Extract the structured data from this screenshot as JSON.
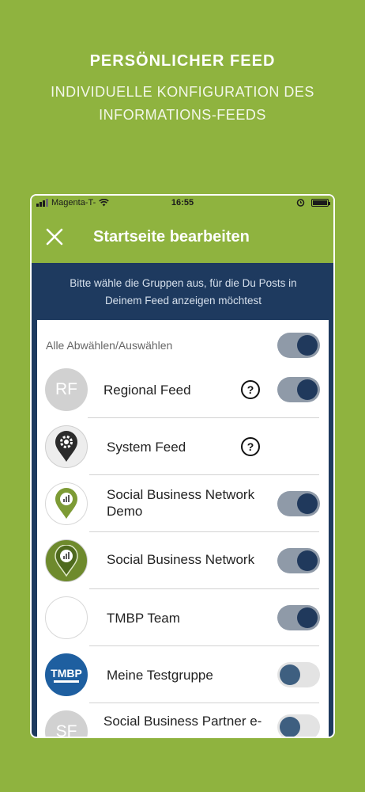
{
  "promo": {
    "title": "PERSÖNLICHER FEED",
    "subtitle_line1": "INDIVIDUELLE KONFIGURATION DES",
    "subtitle_line2": "INFORMATIONS-FEEDS"
  },
  "statusbar": {
    "carrier": "Magenta-T-",
    "time": "16:55"
  },
  "appbar": {
    "close_icon": "close-icon",
    "title": "Startseite bearbeiten"
  },
  "intro": {
    "line1": "Bitte wähle die Gruppen aus, für die Du Posts in",
    "line2": "Deinem Feed anzeigen möchtest"
  },
  "select_all": {
    "label": "Alle Abwählen/Auswählen",
    "on": true
  },
  "groups": [
    {
      "avatar_text": "RF",
      "label": "Regional Feed",
      "help": "?",
      "toggle_on": true
    },
    {
      "icon": "gear-pin-icon",
      "label": "System Feed",
      "help": "?"
    },
    {
      "icon": "map-pin-chart-icon",
      "label": "Social Business Network Demo",
      "toggle_on": true
    },
    {
      "icon": "map-pin-chart-icon",
      "label": "Social Business Network",
      "toggle_on": true
    },
    {
      "label": "TMBP Team",
      "toggle_on": true
    },
    {
      "avatar_text": "TMBP",
      "label": "Meine Testgruppe",
      "toggle_on": false
    },
    {
      "avatar_text": "SF",
      "label": "Social Business Partner e-",
      "toggle_on": false
    }
  ],
  "colors": {
    "brand_green": "#8fb33f",
    "navy": "#1e3a5f",
    "knob": "#20395c"
  }
}
